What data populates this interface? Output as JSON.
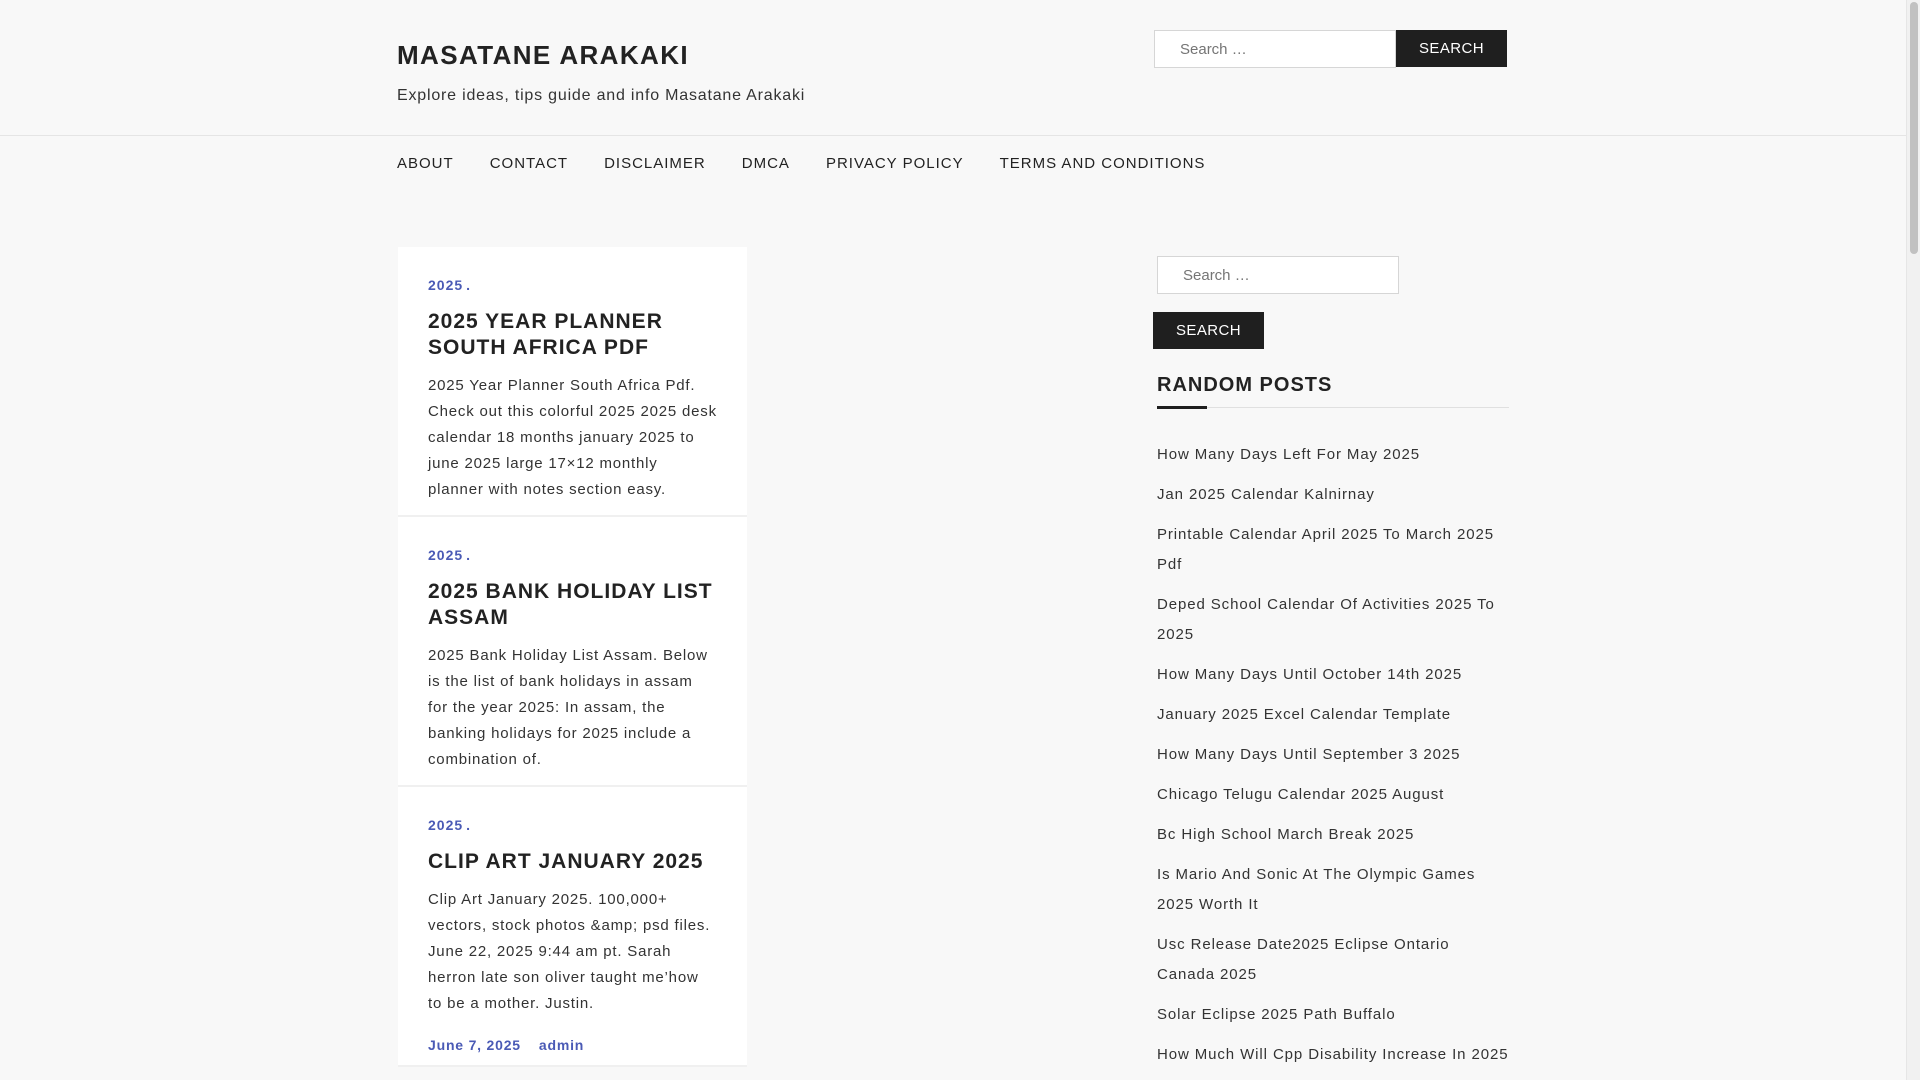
{
  "site": {
    "title": "MASATANE ARAKAKI",
    "description": "Explore ideas, tips guide and info Masatane Arakaki"
  },
  "header_search": {
    "placeholder": "Search …",
    "button_label": "SEARCH"
  },
  "nav": {
    "items": [
      "ABOUT",
      "CONTACT",
      "DISCLAIMER",
      "DMCA",
      "PRIVACY POLICY",
      "TERMS AND CONDITIONS"
    ]
  },
  "posts": [
    {
      "category": "2025",
      "dot": ".",
      "title": "2025 YEAR PLANNER SOUTH AFRICA PDF",
      "excerpt": "2025 Year Planner South Africa Pdf. Check out this colorful 2025 2025 desk calendar 18 months january 2025 to june 2025 large 17×12 monthly planner with notes section easy."
    },
    {
      "category": "2025",
      "dot": ".",
      "title": "2025 BANK HOLIDAY LIST ASSAM",
      "excerpt": "2025 Bank Holiday List Assam. Below is the list of bank holidays in assam for the year 2025: In assam, the banking holidays for 2025 include a combination of."
    },
    {
      "category": "2025",
      "dot": ".",
      "title": "CLIP ART JANUARY 2025",
      "excerpt": "Clip Art January 2025. 100,000+ vectors, stock photos &amp; psd files. June 22, 2025 9:44 am pt. Sarah herron late son oliver taught me’how to be a mother. Justin.",
      "date": "June 7, 2025",
      "author": "admin"
    }
  ],
  "sidebar": {
    "search_placeholder": "Search …",
    "search_button": "SEARCH",
    "widget_title": "RANDOM POSTS",
    "random_posts": [
      "How Many Days Left For May 2025",
      "Jan 2025 Calendar Kalnirnay",
      "Printable Calendar April 2025 To March 2025 Pdf",
      "Deped School Calendar Of Activities 2025 To 2025",
      "How Many Days Until October 14th 2025",
      "January 2025 Excel Calendar Template",
      "How Many Days Until September 3 2025",
      "Chicago Telugu Calendar 2025 August",
      "Bc High School March Break 2025",
      "Is Mario And Sonic At The Olympic Games 2025 Worth It",
      "Usc Release Date2025 Eclipse Ontario Canada 2025",
      "Solar Eclipse 2025 Path Buffalo",
      "How Much Will Cpp Disability Increase In 2025"
    ]
  },
  "colors": {
    "accent": "#4a5ab5",
    "button_bg": "#1f1f1f",
    "page_bg": "#f8f8f8"
  }
}
